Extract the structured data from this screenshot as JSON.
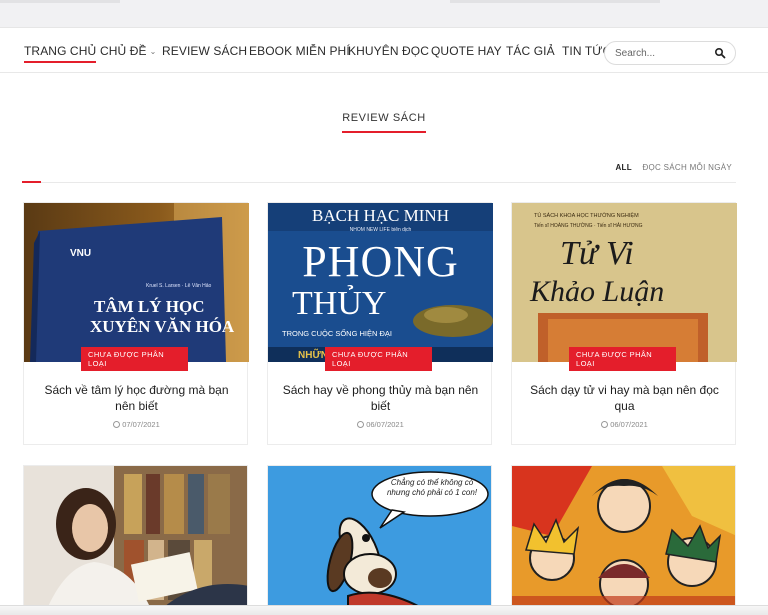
{
  "nav": {
    "items": [
      {
        "label": "TRANG CHỦ",
        "active": true
      },
      {
        "label": "CHỦ ĐỀ",
        "dropdown": true
      },
      {
        "label": "REVIEW SÁCH"
      },
      {
        "label": "EBOOK MIỄN PHÍ"
      },
      {
        "label": "KHUYÊN ĐỌC"
      },
      {
        "label": "QUOTE HAY"
      },
      {
        "label": "TÁC GIẢ"
      },
      {
        "label": "TIN TỨC"
      }
    ],
    "search_placeholder": "Search..."
  },
  "section": {
    "title": "REVIEW SÁCH",
    "filters": [
      "ALL",
      "ĐỌC SÁCH MỖI NGÀY"
    ]
  },
  "cards": [
    {
      "badge": "CHƯA ĐƯỢC PHÂN LOẠI",
      "title": "Sách về tâm lý học đường mà bạn nên biết",
      "date": "07/07/2021",
      "cover": {
        "publisher": "VNU",
        "authors": "Kruel S. Larsen · Lê Văn Hảo",
        "line1": "TÂM LÝ HỌC",
        "line2": "XUYÊN VĂN HÓA"
      }
    },
    {
      "badge": "CHƯA ĐƯỢC PHÂN LOẠI",
      "title": "Sách hay về phong thủy mà bạn nên biết",
      "date": "06/07/2021",
      "cover": {
        "author": "BẠCH HẠC MINH",
        "sub": "NHOM NEW LIFE biên dịch",
        "line1": "PHONG",
        "line2": "THỦY",
        "tagline": "TRONG CUỘC SỐNG HIỆN ĐẠI",
        "footer": "NHỮNG ... KỲ"
      }
    },
    {
      "badge": "CHƯA ĐƯỢC PHÂN LOẠI",
      "title": "Sách dạy tử vi hay mà bạn nên đọc qua",
      "date": "06/07/2021",
      "cover": {
        "series": "TỦ SÁCH KHOA HỌC THƯỜNG NGHIỆM",
        "authors": "Tiến sĩ HOÀNG THƯỜNG · Tiến sĩ HẢI HƯƠNG",
        "line1": "Tử Vi",
        "line2": "Khảo Luận"
      }
    }
  ],
  "second_row": {
    "speech_bubble": "Chẳng có thể không có nhưng chó phải có 1 con!"
  },
  "colors": {
    "accent": "#e41e2b"
  }
}
